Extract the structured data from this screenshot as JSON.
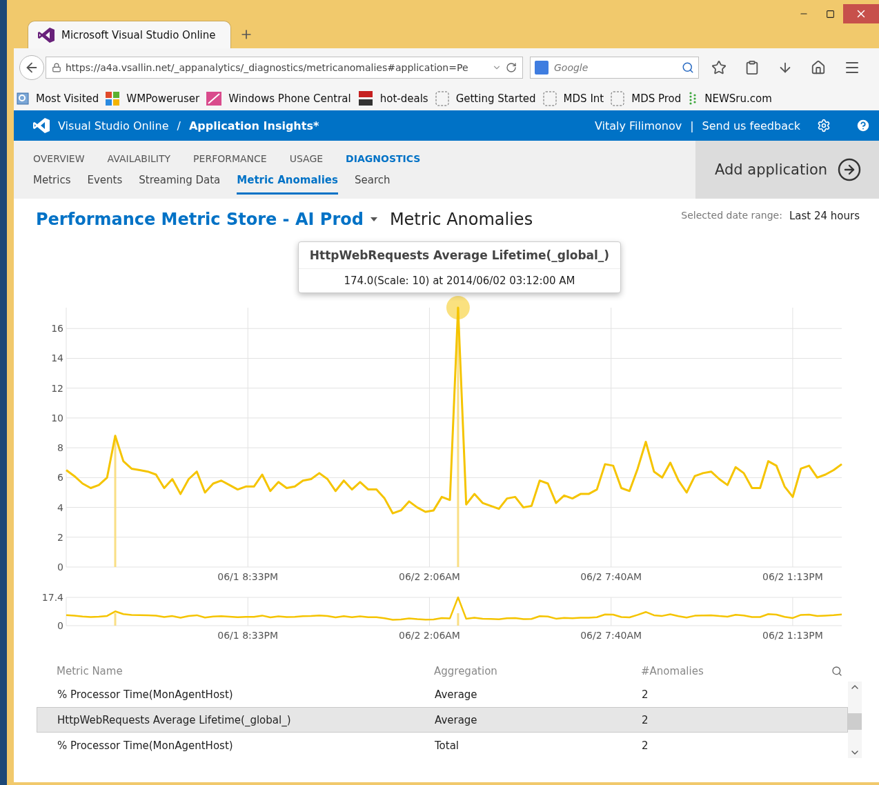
{
  "browser": {
    "tabs": [
      {
        "title": "Microsoft Visual Studio Online",
        "selected": true
      }
    ],
    "address": {
      "url": "https://a4a.vsallin.net/_appanalytics/_diagnostics/metricanomalies#application=Pe"
    },
    "search": {
      "placeholder": "Google"
    },
    "bookmarks": [
      {
        "label": "Most Visited",
        "kind": "app"
      },
      {
        "label": "WMPoweruser",
        "kind": "tiles"
      },
      {
        "label": "Windows Phone Central",
        "kind": "flag"
      },
      {
        "label": "hot-deals",
        "kind": "hot"
      },
      {
        "label": "Getting Started",
        "kind": "blank"
      },
      {
        "label": "MDS Int",
        "kind": "blank"
      },
      {
        "label": "MDS Prod",
        "kind": "blank"
      },
      {
        "label": "NEWSru.com",
        "kind": "dots"
      }
    ]
  },
  "app_header": {
    "product": "Visual Studio Online",
    "separator": "/",
    "app": "Application Insights*",
    "user": "Vitaly Filimonov",
    "divider": "|",
    "feedback": "Send us feedback"
  },
  "main_tabs": [
    {
      "label": "OVERVIEW",
      "selected": false
    },
    {
      "label": "AVAILABILITY",
      "selected": false
    },
    {
      "label": "PERFORMANCE",
      "selected": false
    },
    {
      "label": "USAGE",
      "selected": false
    },
    {
      "label": "DIAGNOSTICS",
      "selected": true
    }
  ],
  "sub_tabs": [
    {
      "label": "Metrics",
      "selected": false
    },
    {
      "label": "Events",
      "selected": false
    },
    {
      "label": "Streaming Data",
      "selected": false
    },
    {
      "label": "Metric Anomalies",
      "selected": true
    },
    {
      "label": "Search",
      "selected": false
    }
  ],
  "add_application": "Add application",
  "page": {
    "resource": "Performance Metric Store - AI Prod",
    "title": "Metric Anomalies",
    "date_range_label": "Selected date range:",
    "date_range": "Last 24 hours"
  },
  "tooltip": {
    "title": "HttpWebRequests Average Lifetime(_global_)",
    "text": "174.0(Scale: 10) at 2014/06/02 03:12:00 AM"
  },
  "main_chart": {
    "x_labels": [
      "06/1 8:33PM",
      "06/2 2:06AM",
      "06/2 7:40AM",
      "06/2 1:13PM"
    ],
    "chart_data": {
      "type": "line",
      "grid": true,
      "ylim": [
        0,
        17.4
      ],
      "yticks": [
        0,
        2,
        4,
        6,
        8,
        10,
        12,
        14,
        16
      ],
      "series": [
        {
          "color": "#f5c400",
          "values": [
            6.5,
            6.1,
            5.6,
            5.3,
            5.5,
            6.0,
            8.8,
            7.1,
            6.6,
            6.5,
            6.4,
            6.2,
            5.3,
            5.9,
            4.9,
            5.9,
            6.4,
            5.0,
            5.6,
            5.8,
            5.5,
            5.2,
            5.4,
            5.4,
            6.2,
            5.1,
            5.7,
            5.3,
            5.4,
            5.8,
            5.9,
            6.3,
            5.9,
            5.1,
            5.8,
            5.2,
            5.7,
            5.2,
            5.2,
            4.6,
            3.6,
            3.8,
            4.4,
            4.0,
            3.7,
            3.8,
            4.7,
            4.5,
            17.4,
            4.2,
            4.9,
            4.3,
            4.1,
            3.9,
            4.6,
            4.7,
            4.0,
            4.1,
            5.8,
            5.6,
            4.3,
            4.8,
            4.6,
            4.9,
            4.9,
            5.2,
            6.9,
            6.8,
            5.3,
            5.1,
            6.6,
            8.4,
            6.4,
            6.0,
            7.0,
            5.8,
            5.0,
            6.1,
            6.3,
            6.4,
            5.9,
            5.5,
            6.7,
            6.3,
            5.3,
            5.3,
            7.1,
            6.8,
            5.4,
            4.7,
            6.6,
            6.8,
            6.0,
            6.2,
            6.5,
            6.9
          ]
        }
      ]
    }
  },
  "overview_chart": {
    "x_labels": [
      "06/1 8:33PM",
      "06/2 2:06AM",
      "06/2 7:40AM",
      "06/2 1:13PM"
    ],
    "chart_data": {
      "type": "line",
      "grid": true,
      "ylim": [
        0,
        17.4
      ],
      "yticks": [
        0,
        {
          "value": 17.4,
          "label": "17.4"
        }
      ],
      "series": [
        {
          "color": "#f5c400",
          "values": [
            6.5,
            6.1,
            5.6,
            5.3,
            5.5,
            6.0,
            8.8,
            7.1,
            6.6,
            6.5,
            6.4,
            6.2,
            5.3,
            5.9,
            4.9,
            5.9,
            6.4,
            5.0,
            5.6,
            5.8,
            5.5,
            5.2,
            5.4,
            5.4,
            6.2,
            5.1,
            5.7,
            5.3,
            5.4,
            5.8,
            5.9,
            6.3,
            5.9,
            5.1,
            5.8,
            5.2,
            5.7,
            5.2,
            5.2,
            4.6,
            3.6,
            3.8,
            4.4,
            4.0,
            3.7,
            3.8,
            4.7,
            4.5,
            17.4,
            4.2,
            4.9,
            4.3,
            4.1,
            3.9,
            4.6,
            4.7,
            4.0,
            4.1,
            5.8,
            5.6,
            4.3,
            4.8,
            4.6,
            4.9,
            4.9,
            5.2,
            6.9,
            6.8,
            5.3,
            5.1,
            6.6,
            8.4,
            6.4,
            6.0,
            7.0,
            5.8,
            5.0,
            6.1,
            6.3,
            6.4,
            5.9,
            5.5,
            6.7,
            6.3,
            5.3,
            5.3,
            7.1,
            6.8,
            5.4,
            4.7,
            6.6,
            6.8,
            6.0,
            6.2,
            6.5,
            6.9
          ]
        }
      ]
    }
  },
  "table": {
    "columns": [
      "Metric Name",
      "Aggregation",
      "#Anomalies"
    ],
    "rows": [
      {
        "cells": [
          "% Processor Time(MonAgentHost)",
          "Average",
          "2"
        ],
        "selected": false
      },
      {
        "cells": [
          "HttpWebRequests Average Lifetime(_global_)",
          "Average",
          "2"
        ],
        "selected": true
      },
      {
        "cells": [
          "% Processor Time(MonAgentHost)",
          "Total",
          "2"
        ],
        "selected": false
      }
    ]
  }
}
